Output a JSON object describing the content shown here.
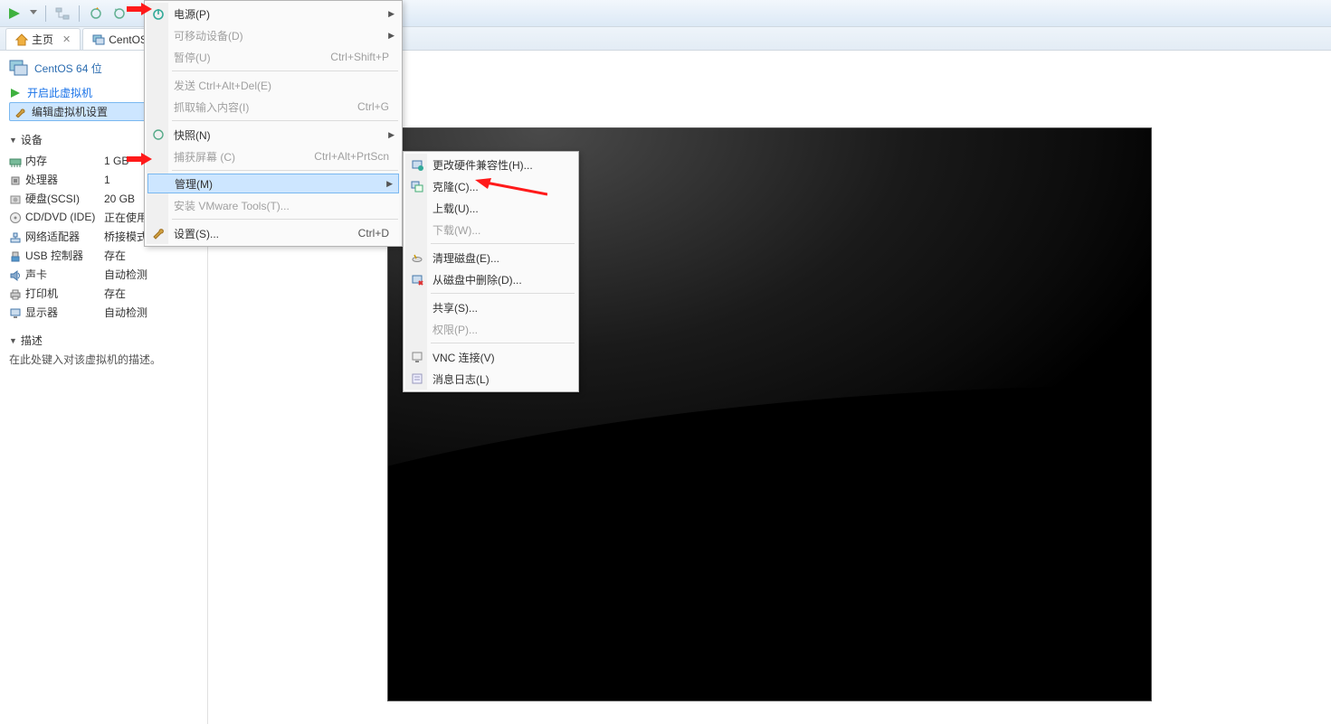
{
  "toolbar": {},
  "tabs": {
    "home": "主页",
    "vm": "CentOS 64"
  },
  "title": "CentOS 64 位",
  "actions": {
    "power_on": "开启此虚拟机",
    "edit_settings": "编辑虚拟机设置"
  },
  "sections": {
    "devices": "设备",
    "description": "描述"
  },
  "devices": [
    {
      "name": "内存",
      "value": "1 GB",
      "icon": "memory"
    },
    {
      "name": "处理器",
      "value": "1",
      "icon": "cpu"
    },
    {
      "name": "硬盘(SCSI)",
      "value": "20 GB",
      "icon": "hdd"
    },
    {
      "name": "CD/DVD (IDE)",
      "value": "正在使用文件 E:...",
      "icon": "cd"
    },
    {
      "name": "网络适配器",
      "value": "桥接模式(自动)",
      "icon": "net"
    },
    {
      "name": "USB 控制器",
      "value": "存在",
      "icon": "usb"
    },
    {
      "name": "声卡",
      "value": "自动检测",
      "icon": "sound"
    },
    {
      "name": "打印机",
      "value": "存在",
      "icon": "printer"
    },
    {
      "name": "显示器",
      "value": "自动检测",
      "icon": "display"
    }
  ],
  "description_placeholder": "在此处键入对该虚拟机的描述。",
  "menu1": {
    "power": "电源(P)",
    "removable": "可移动设备(D)",
    "pause": "暂停(U)",
    "pause_sc": "Ctrl+Shift+P",
    "send_cad": "发送 Ctrl+Alt+Del(E)",
    "grab_input": "抓取输入内容(I)",
    "grab_input_sc": "Ctrl+G",
    "snapshot": "快照(N)",
    "capture": "捕获屏幕 (C)",
    "capture_sc": "Ctrl+Alt+PrtScn",
    "manage": "管理(M)",
    "install_tools": "安装 VMware Tools(T)...",
    "settings": "设置(S)...",
    "settings_sc": "Ctrl+D"
  },
  "menu2": {
    "change_hw": "更改硬件兼容性(H)...",
    "clone": "克隆(C)...",
    "upload": "上载(U)...",
    "download": "下载(W)...",
    "cleanup": "清理磁盘(E)...",
    "delete": "从磁盘中删除(D)...",
    "share": "共享(S)...",
    "permissions": "权限(P)...",
    "vnc": "VNC 连接(V)",
    "msglog": "消息日志(L)"
  }
}
